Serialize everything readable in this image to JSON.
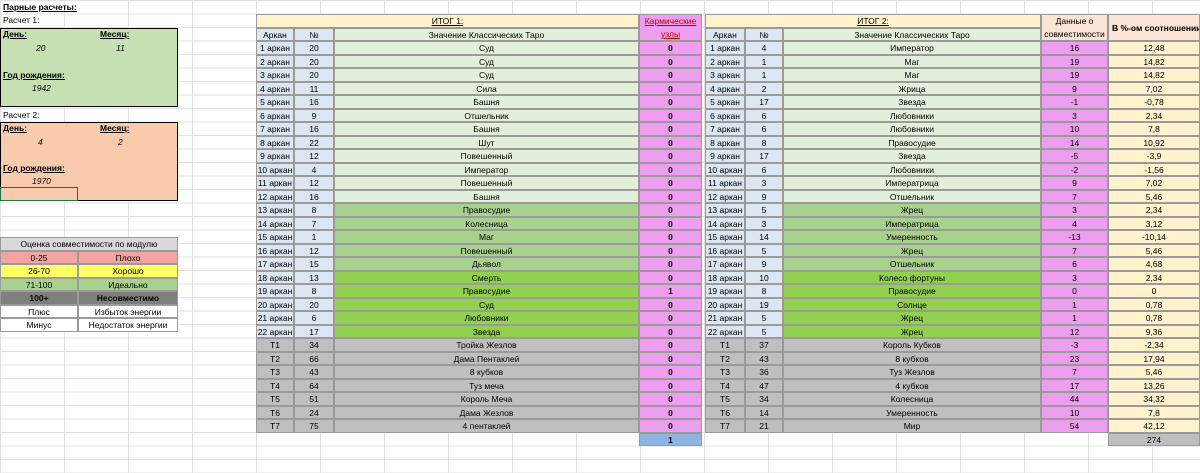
{
  "left": {
    "title": "Парные расчеты:",
    "calc1": {
      "label": "Расчет 1:",
      "day_label": "День:",
      "month_label": "Месяц:",
      "day": "20",
      "month": "11",
      "year_label": "Год рождения:",
      "year": "1942"
    },
    "calc2": {
      "label": "Расчет 2:",
      "day_label": "День:",
      "month_label": "Месяц:",
      "day": "4",
      "month": "2",
      "year_label": "Год рождения:",
      "year": "1970"
    },
    "legend": {
      "title": "Оценка совместимости по модулю",
      "rows": [
        {
          "range": "0-25",
          "text": "Плохо",
          "color": "#f4a3a3"
        },
        {
          "range": "26-70",
          "text": "Хорошо",
          "color": "#ffff66"
        },
        {
          "range": "71-100",
          "text": "Идеально",
          "color": "#a9d18e"
        },
        {
          "range": "100+",
          "text": "Несовместимо",
          "color": "#7f7f7f"
        },
        {
          "range": "Плюс",
          "text": "Избыток энергии",
          "color": "#ffffff"
        },
        {
          "range": "Минус",
          "text": "Недостаток энергии",
          "color": "#ffffff"
        }
      ]
    }
  },
  "headers": {
    "itog1": "ИТОГ 1:",
    "itog2": "ИТОГ 2:",
    "karmic_l1": "Кармические",
    "karmic_l2": "узлы",
    "arkan": "Аркан",
    "num": "№",
    "meaning": "Значение Классических Таро",
    "compat_l1": "Данные о",
    "compat_l2": "совместимости",
    "percent": "В %-ом соотношении"
  },
  "rows": [
    [
      "1 аркан",
      "20",
      "Суд",
      "0",
      "1 аркан",
      "4",
      "Император",
      "16",
      "12,48"
    ],
    [
      "2 аркан",
      "20",
      "Суд",
      "0",
      "2 аркан",
      "1",
      "Маг",
      "19",
      "14,82"
    ],
    [
      "3 аркан",
      "20",
      "Суд",
      "0",
      "3 аркан",
      "1",
      "Маг",
      "19",
      "14,82"
    ],
    [
      "4 аркан",
      "11",
      "Сила",
      "0",
      "4 аркан",
      "2",
      "Жрица",
      "9",
      "7,02"
    ],
    [
      "5 аркан",
      "16",
      "Башня",
      "0",
      "5 аркан",
      "17",
      "Звезда",
      "-1",
      "-0,78"
    ],
    [
      "6 аркан",
      "9",
      "Отшельник",
      "0",
      "6 аркан",
      "6",
      "Любовники",
      "3",
      "2,34"
    ],
    [
      "7 аркан",
      "16",
      "Башня",
      "0",
      "7 аркан",
      "6",
      "Любовники",
      "10",
      "7,8"
    ],
    [
      "8 аркан",
      "22",
      "Шут",
      "0",
      "8 аркан",
      "8",
      "Правосудие",
      "14",
      "10,92"
    ],
    [
      "9 аркан",
      "12",
      "Повешенный",
      "0",
      "9 аркан",
      "17",
      "Звезда",
      "-5",
      "-3,9"
    ],
    [
      "10 аркан",
      "4",
      "Император",
      "0",
      "10 аркан",
      "6",
      "Любовники",
      "-2",
      "-1,56"
    ],
    [
      "11 аркан",
      "12",
      "Повешенный",
      "0",
      "11 аркан",
      "3",
      "Императрица",
      "9",
      "7,02"
    ],
    [
      "12 аркан",
      "16",
      "Башня",
      "0",
      "12 аркан",
      "9",
      "Отшельник",
      "7",
      "5,46"
    ],
    [
      "13 аркан",
      "8",
      "Правосудие",
      "0",
      "13 аркан",
      "5",
      "Жрец",
      "3",
      "2,34"
    ],
    [
      "14 аркан",
      "7",
      "Колесница",
      "0",
      "14 аркан",
      "3",
      "Императрица",
      "4",
      "3,12"
    ],
    [
      "15 аркан",
      "1",
      "Маг",
      "0",
      "15 аркан",
      "14",
      "Умеренность",
      "-13",
      "-10,14"
    ],
    [
      "16 аркан",
      "12",
      "Повешенный",
      "0",
      "16 аркан",
      "5",
      "Жрец",
      "7",
      "5,46"
    ],
    [
      "17 аркан",
      "15",
      "Дьявол",
      "0",
      "17 аркан",
      "9",
      "Отшельник",
      "6",
      "4,68"
    ],
    [
      "18 аркан",
      "13",
      "Смерть",
      "0",
      "18 аркан",
      "10",
      "Колесо фортуны",
      "3",
      "2,34"
    ],
    [
      "19 аркан",
      "8",
      "Правосудие",
      "1",
      "19 аркан",
      "8",
      "Правосудие",
      "0",
      "0"
    ],
    [
      "20 аркан",
      "20",
      "Суд",
      "0",
      "20 аркан",
      "19",
      "Солнце",
      "1",
      "0,78"
    ],
    [
      "21 аркан",
      "6",
      "Любовники",
      "0",
      "21 аркан",
      "5",
      "Жрец",
      "1",
      "0,78"
    ],
    [
      "22 аркан",
      "17",
      "Звезда",
      "0",
      "22 аркан",
      "5",
      "Жрец",
      "12",
      "9,36"
    ],
    [
      "Т1",
      "34",
      "Тройка Жезлов",
      "0",
      "Т1",
      "37",
      "Король Кубков",
      "-3",
      "-2,34"
    ],
    [
      "Т2",
      "66",
      "Дама Пентаклей",
      "0",
      "Т2",
      "43",
      "8 кубков",
      "23",
      "17,94"
    ],
    [
      "Т3",
      "43",
      "8 кубков",
      "0",
      "Т3",
      "36",
      "Туз Жезлов",
      "7",
      "5,46"
    ],
    [
      "Т4",
      "64",
      "Туз меча",
      "0",
      "Т4",
      "47",
      "4 кубков",
      "17",
      "13,26"
    ],
    [
      "Т5",
      "51",
      "Король Меча",
      "0",
      "Т5",
      "34",
      "Колесница",
      "44",
      "34,32"
    ],
    [
      "Т6",
      "24",
      "Дама Жезлов",
      "0",
      "Т6",
      "14",
      "Умеренность",
      "10",
      "7,8"
    ],
    [
      "Т7",
      "75",
      "4 пентаклей",
      "0",
      "Т7",
      "21",
      "Мир",
      "54",
      "42,12"
    ]
  ],
  "totals": {
    "karmic": "1",
    "percent": "274"
  },
  "colors": {
    "light_green": "#e2efda",
    "mid_green": "#a9d18e",
    "bright_green": "#92d050",
    "gray": "#bfbfbf",
    "pink": "#ee9eee",
    "blue_cell": "#dce6f1",
    "peach": "#f8cbad",
    "yellow": "#fff2cc",
    "header_peach": "#fce4d6"
  }
}
